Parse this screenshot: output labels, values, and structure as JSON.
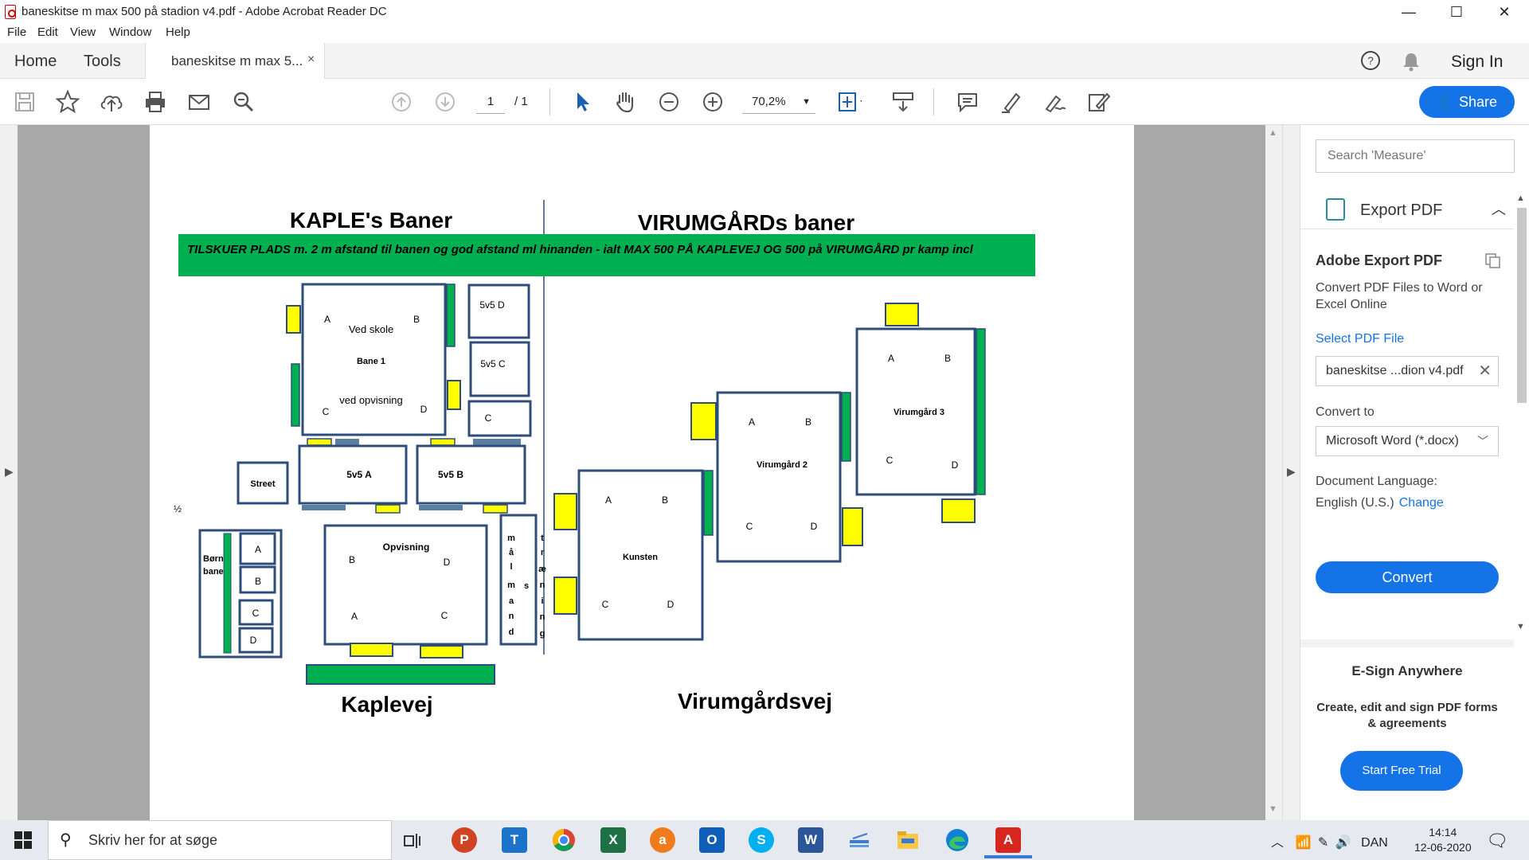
{
  "window": {
    "title": "baneskitse m max 500 på stadion v4.pdf - Adobe Acrobat Reader DC",
    "controls": {
      "minimize": "—",
      "maximize": "☐",
      "close": "✕"
    }
  },
  "menu": [
    "File",
    "Edit",
    "View",
    "Window",
    "Help"
  ],
  "tabs": {
    "home": "Home",
    "tools": "Tools",
    "document": "baneskitse m max 5...",
    "close_glyph": "×",
    "sign_in": "Sign In"
  },
  "toolbar": {
    "page_current": "1",
    "page_total": "/ 1",
    "zoom": "70,2%",
    "share_label": "Share"
  },
  "document": {
    "heading_left": "KAPLE's Baner",
    "heading_right": "VIRUMGÅRDs baner",
    "banner": "TILSKUER PLADS m. 2 m afstand til banen og god afstand ml hinanden - ialt MAX 500  PÅ KAPLEVEJ OG 500 på VIRUMGÅRD pr kamp incl",
    "road_left": "Kaplevej",
    "road_right": "Virumgårdsvej",
    "half_mark": "½",
    "labels": {
      "street": "Street",
      "v5d": "5v5 D",
      "v5c": "5v5 C",
      "c_small": "C",
      "v5a": "5v5 A",
      "v5b": "5v5 B",
      "bane1_a": "A",
      "bane1_b": "B",
      "bane1_skole": "Ved skole",
      "bane1": "Bane 1",
      "bane1_opv": "ved opvisning",
      "bane1_c": "C",
      "bane1_d": "D",
      "born1": "Børn",
      "born2": "bane",
      "kid_a": "A",
      "kid_b": "B",
      "kid_c": "C",
      "kid_d": "D",
      "opvisning": "Opvisning",
      "opv_b": "B",
      "opv_d": "D",
      "opv_a": "A",
      "opv_c": "C",
      "maalmand": [
        "m",
        "å",
        "l",
        "m",
        "a",
        "n",
        "d"
      ],
      "traening_s": "s",
      "traening": [
        "t",
        "r",
        "æ",
        "n",
        "i",
        "n",
        "g"
      ],
      "kunsten": "Kunsten",
      "k_a": "A",
      "k_b": "B",
      "k_c": "C",
      "k_d": "D",
      "vg2": "Virumgård 2",
      "vg2_a": "A",
      "vg2_b": "B",
      "vg2_c": "C",
      "vg2_d": "D",
      "vg3": "Virumgård 3",
      "vg3_a": "A",
      "vg3_b": "B",
      "vg3_c": "C",
      "vg3_d": "D"
    }
  },
  "right_panel": {
    "search_placeholder": "Search 'Measure'",
    "export_title": "Export PDF",
    "aep_title": "Adobe Export PDF",
    "aep_desc": "Convert PDF Files to Word or Excel Online",
    "select_file": "Select PDF File",
    "file_name": "baneskitse ...dion v4.pdf",
    "convert_to": "Convert to",
    "format": "Microsoft Word (*.docx)",
    "doc_lang_label": "Document Language:",
    "doc_lang": "English (U.S.)",
    "change": "Change",
    "convert_btn": "Convert",
    "esign_title": "E-Sign Anywhere",
    "esign_desc": "Create, edit and sign PDF forms & agreements",
    "trial_btn": "Start Free Trial"
  },
  "taskbar": {
    "search_placeholder": "Skriv her for at søge",
    "language": "DAN",
    "time": "14:14",
    "date": "12-06-2020"
  },
  "colors": {
    "accent": "#1473e6",
    "box_border": "#2e4d7b",
    "field_green": "#00b050",
    "yellow": "#ffff00"
  }
}
